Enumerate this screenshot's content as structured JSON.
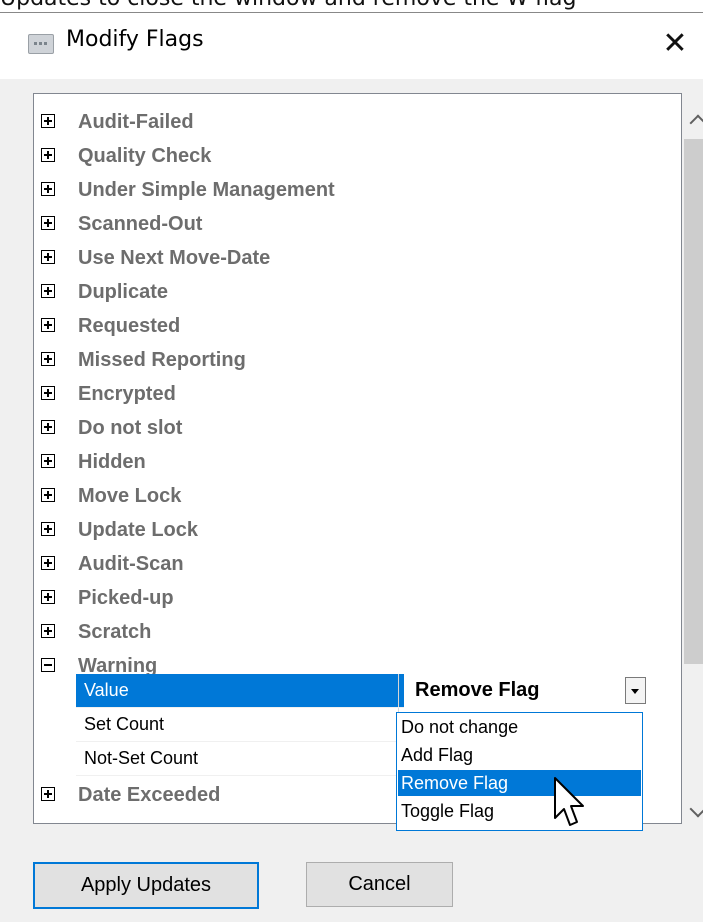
{
  "caption_text": "Updates to close the window and remove the W flag",
  "window": {
    "title": "Modify Flags",
    "close_glyph": "✕"
  },
  "flags": [
    {
      "label": "Audit-Failed",
      "expanded": false
    },
    {
      "label": "Quality Check",
      "expanded": false
    },
    {
      "label": "Under Simple Management",
      "expanded": false
    },
    {
      "label": "Scanned-Out",
      "expanded": false
    },
    {
      "label": "Use Next Move-Date",
      "expanded": false
    },
    {
      "label": "Duplicate",
      "expanded": false
    },
    {
      "label": "Requested",
      "expanded": false
    },
    {
      "label": "Missed Reporting",
      "expanded": false
    },
    {
      "label": "Encrypted",
      "expanded": false
    },
    {
      "label": "Do not slot",
      "expanded": false
    },
    {
      "label": "Hidden",
      "expanded": false
    },
    {
      "label": "Move Lock",
      "expanded": false
    },
    {
      "label": "Update Lock",
      "expanded": false
    },
    {
      "label": "Audit-Scan",
      "expanded": false
    },
    {
      "label": "Picked-up",
      "expanded": false
    },
    {
      "label": "Scratch",
      "expanded": false
    },
    {
      "label": "Warning",
      "expanded": true
    }
  ],
  "warning_properties": {
    "value_label": "Value",
    "value_current": "Remove Flag",
    "set_count_label": "Set Count",
    "not_set_count_label": "Not-Set Count"
  },
  "trailing_flag": {
    "label": "Date Exceeded",
    "expanded": false
  },
  "dropdown_options": [
    "Do not change",
    "Add Flag",
    "Remove Flag",
    "Toggle Flag"
  ],
  "dropdown_selected": "Remove Flag",
  "buttons": {
    "apply": "Apply Updates",
    "cancel": "Cancel"
  },
  "colors": {
    "selection": "#0078d7",
    "category_text": "#6d6d6d",
    "dialog_bg": "#f0f0f0"
  }
}
